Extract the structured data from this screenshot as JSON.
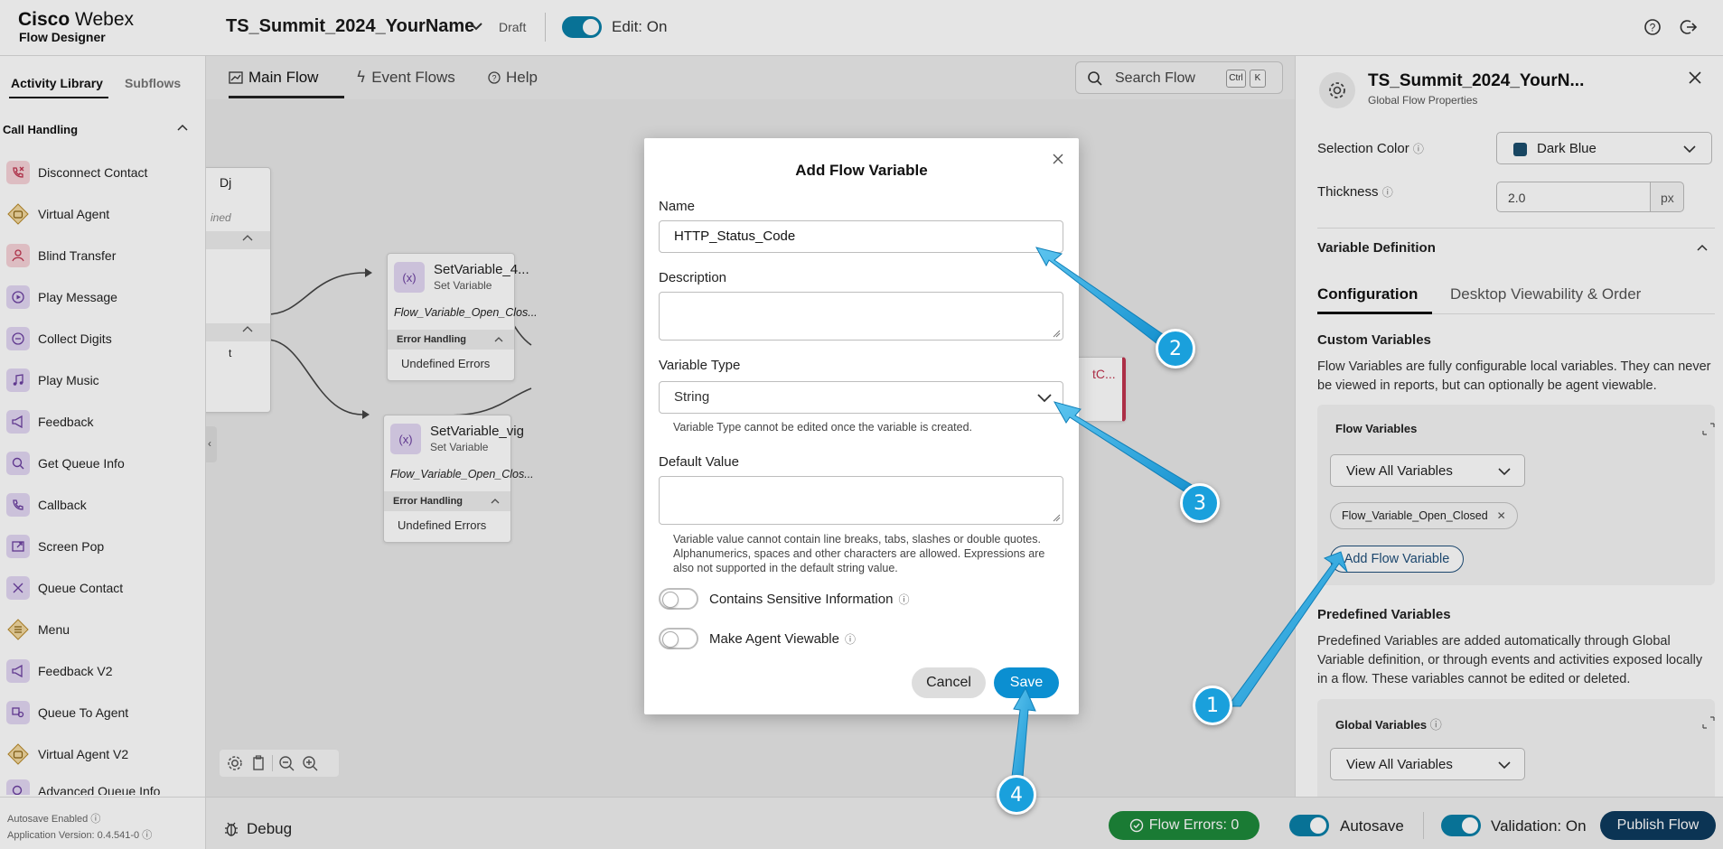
{
  "app": {
    "brand_name": "Webex",
    "brand_prefix": "Cisco",
    "product": "Flow Designer",
    "flow_name": "TS_Summit_2024_YourName",
    "status": "Draft",
    "edit_toggle_label": "Edit: On"
  },
  "left_panel": {
    "tabs": [
      "Activity Library",
      "Subflows"
    ],
    "category": "Call Handling",
    "activities": [
      {
        "label": "Disconnect Contact",
        "icon": "phone-disconnect-icon"
      },
      {
        "label": "Virtual Agent",
        "icon": "virtual-agent-icon"
      },
      {
        "label": "Blind Transfer",
        "icon": "blind-transfer-icon"
      },
      {
        "label": "Play Message",
        "icon": "play-message-icon"
      },
      {
        "label": "Collect Digits",
        "icon": "collect-digits-icon"
      },
      {
        "label": "Play Music",
        "icon": "music-note-icon"
      },
      {
        "label": "Feedback",
        "icon": "megaphone-icon"
      },
      {
        "label": "Get Queue Info",
        "icon": "search-icon"
      },
      {
        "label": "Callback",
        "icon": "callback-icon"
      },
      {
        "label": "Screen Pop",
        "icon": "screen-pop-icon"
      },
      {
        "label": "Queue Contact",
        "icon": "queue-contact-icon"
      },
      {
        "label": "Menu",
        "icon": "menu-icon"
      },
      {
        "label": "Feedback V2",
        "icon": "megaphone-icon"
      },
      {
        "label": "Queue To Agent",
        "icon": "queue-to-agent-icon"
      },
      {
        "label": "Virtual Agent V2",
        "icon": "virtual-agent-icon"
      },
      {
        "label": "Advanced Queue Info",
        "icon": "search-icon"
      }
    ],
    "autosave": "Autosave Enabled",
    "version": "Application Version: 0.4.541-0"
  },
  "canvas": {
    "tabs": [
      "Main Flow",
      "Event Flows",
      "Help"
    ],
    "search_placeholder": "Search Flow",
    "shortcut_keys": [
      "Ctrl",
      "K"
    ],
    "partial_node_text": {
      "title_fragment": "Dj",
      "sub_fragment": "ined",
      "row_fragment": "t"
    },
    "partial_node_right": "tC...",
    "nodes": [
      {
        "title": "SetVariable_4...",
        "subtitle": "Set Variable",
        "variable": "Flow_Variable_Open_Clos...",
        "error_header": "Error Handling",
        "error_item": "Undefined Errors",
        "icon_text": "(x)"
      },
      {
        "title": "SetVariable_vig",
        "subtitle": "Set Variable",
        "variable": "Flow_Variable_Open_Clos...",
        "error_header": "Error Handling",
        "error_item": "Undefined Errors",
        "icon_text": "(x)"
      }
    ]
  },
  "bottom_bar": {
    "debug": "Debug",
    "flow_errors": "Flow Errors: 0",
    "autosave": "Autosave",
    "validation": "Validation: On",
    "publish": "Publish Flow"
  },
  "right_panel": {
    "title": "TS_Summit_2024_YourN...",
    "subtitle": "Global Flow Properties",
    "selection_color_label": "Selection Color",
    "selection_color_value": "Dark Blue",
    "selection_color_hex": "#1b4f6e",
    "thickness_label": "Thickness",
    "thickness_value": "2.0",
    "thickness_unit": "px",
    "variable_definition": "Variable Definition",
    "tabs": [
      "Configuration",
      "Desktop Viewability & Order"
    ],
    "custom_variables_header": "Custom Variables",
    "custom_variables_text": "Flow Variables are fully configurable local variables. They can never be viewed in reports, but can optionally be agent viewable.",
    "flow_variables_header": "Flow Variables",
    "view_all": "View All Variables",
    "chip": "Flow_Variable_Open_Closed",
    "add_flow_variable": "Add Flow Variable",
    "predefined_header": "Predefined Variables",
    "predefined_text": "Predefined Variables are added automatically through Global Variable definition, or through events and activities exposed locally in a flow. These variables cannot be edited or deleted.",
    "global_variables_header": "Global Variables",
    "view_all_2": "View All Variables"
  },
  "modal": {
    "title": "Add Flow Variable",
    "name_label": "Name",
    "name_value": "HTTP_Status_Code",
    "description_label": "Description",
    "variable_type_label": "Variable Type",
    "variable_type_value": "String",
    "variable_type_help": "Variable Type cannot be edited once the variable is created.",
    "default_value_label": "Default Value",
    "default_value_help": "Variable value cannot contain line breaks, tabs, slashes or double quotes. Alphanumerics, spaces and other characters are allowed. Expressions are also not supported in the default string value.",
    "sensitive_label": "Contains Sensitive Information",
    "agent_viewable_label": "Make Agent Viewable",
    "cancel": "Cancel",
    "save": "Save"
  },
  "annotations": [
    "1",
    "2",
    "3",
    "4"
  ],
  "colors": {
    "accent": "#0b8fd1",
    "toggle_on": "#0a7fa8",
    "annotation": "#1aa0dc",
    "publish": "#0d3a5e",
    "errors_ok": "#1e8a3a"
  }
}
